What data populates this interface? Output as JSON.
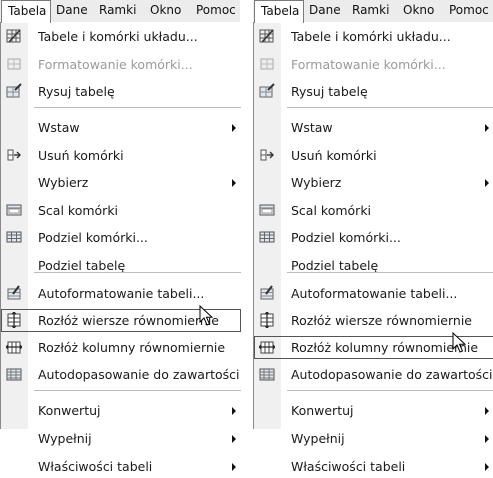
{
  "left": {
    "menubar": [
      "Tabela",
      "Dane",
      "Ramki",
      "Okno",
      "Pomoc"
    ],
    "items": [
      {
        "label": "Tabele i komórki układu...",
        "icon": "pen-grid-icon",
        "submenu": false,
        "disabled": false,
        "highlighted": false
      },
      {
        "label": "Formatowanie komórki...",
        "icon": "cell-format-icon",
        "submenu": false,
        "disabled": true,
        "highlighted": false
      },
      {
        "label": "Rysuj tabelę",
        "icon": "draw-table-icon",
        "submenu": false,
        "disabled": false,
        "highlighted": false
      },
      {
        "label": "Wstaw",
        "icon": "",
        "submenu": true,
        "disabled": false,
        "highlighted": false
      },
      {
        "label": "Usuń komórki",
        "icon": "delete-cells-icon",
        "submenu": false,
        "disabled": false,
        "highlighted": false
      },
      {
        "label": "Wybierz",
        "icon": "",
        "submenu": true,
        "disabled": false,
        "highlighted": false
      },
      {
        "label": "Scal komórki",
        "icon": "merge-cells-icon",
        "submenu": false,
        "disabled": false,
        "highlighted": false
      },
      {
        "label": "Podziel komórki...",
        "icon": "split-cells-icon",
        "submenu": false,
        "disabled": false,
        "highlighted": false
      },
      {
        "label": "Podziel tabelę",
        "icon": "",
        "submenu": false,
        "disabled": false,
        "highlighted": false
      },
      {
        "label": "Autoformatowanie tabeli...",
        "icon": "autoformat-icon",
        "submenu": false,
        "disabled": false,
        "highlighted": false
      },
      {
        "label": "Rozłóż wiersze równomiernie",
        "icon": "distribute-rows-icon",
        "submenu": false,
        "disabled": false,
        "highlighted": true
      },
      {
        "label": "Rozłóż kolumny równomiernie",
        "icon": "distribute-columns-icon",
        "submenu": false,
        "disabled": false,
        "highlighted": false
      },
      {
        "label": "Autodopasowanie do zawartości",
        "icon": "autofit-icon",
        "submenu": false,
        "disabled": false,
        "highlighted": false
      },
      {
        "label": "Konwertuj",
        "icon": "",
        "submenu": true,
        "disabled": false,
        "highlighted": false
      },
      {
        "label": "Wypełnij",
        "icon": "",
        "submenu": true,
        "disabled": false,
        "highlighted": false
      },
      {
        "label": "Właściwości tabeli",
        "icon": "",
        "submenu": true,
        "disabled": false,
        "highlighted": false
      }
    ]
  },
  "right": {
    "menubar": [
      "Tabela",
      "Dane",
      "Ramki",
      "Okno",
      "Pomoc"
    ],
    "items": [
      {
        "label": "Tabele i komórki układu...",
        "icon": "pen-grid-icon",
        "submenu": false,
        "disabled": false,
        "highlighted": false
      },
      {
        "label": "Formatowanie komórki...",
        "icon": "cell-format-icon",
        "submenu": false,
        "disabled": true,
        "highlighted": false
      },
      {
        "label": "Rysuj tabelę",
        "icon": "draw-table-icon",
        "submenu": false,
        "disabled": false,
        "highlighted": false
      },
      {
        "label": "Wstaw",
        "icon": "",
        "submenu": true,
        "disabled": false,
        "highlighted": false
      },
      {
        "label": "Usuń komórki",
        "icon": "delete-cells-icon",
        "submenu": false,
        "disabled": false,
        "highlighted": false
      },
      {
        "label": "Wybierz",
        "icon": "",
        "submenu": true,
        "disabled": false,
        "highlighted": false
      },
      {
        "label": "Scal komórki",
        "icon": "merge-cells-icon",
        "submenu": false,
        "disabled": false,
        "highlighted": false
      },
      {
        "label": "Podziel komórki...",
        "icon": "split-cells-icon",
        "submenu": false,
        "disabled": false,
        "highlighted": false
      },
      {
        "label": "Podziel tabelę",
        "icon": "",
        "submenu": false,
        "disabled": false,
        "highlighted": false
      },
      {
        "label": "Autoformatowanie tabeli...",
        "icon": "autoformat-icon",
        "submenu": false,
        "disabled": false,
        "highlighted": false
      },
      {
        "label": "Rozłóż wiersze równomiernie",
        "icon": "distribute-rows-icon",
        "submenu": false,
        "disabled": false,
        "highlighted": false
      },
      {
        "label": "Rozłóż kolumny równomiernie",
        "icon": "distribute-columns-icon",
        "submenu": false,
        "disabled": false,
        "highlighted": true
      },
      {
        "label": "Autodopasowanie do zawartości",
        "icon": "autofit-icon",
        "submenu": false,
        "disabled": false,
        "highlighted": false
      },
      {
        "label": "Konwertuj",
        "icon": "",
        "submenu": true,
        "disabled": false,
        "highlighted": false
      },
      {
        "label": "Wypełnij",
        "icon": "",
        "submenu": true,
        "disabled": false,
        "highlighted": false
      },
      {
        "label": "Właściwości tabeli",
        "icon": "",
        "submenu": true,
        "disabled": false,
        "highlighted": false
      }
    ]
  }
}
